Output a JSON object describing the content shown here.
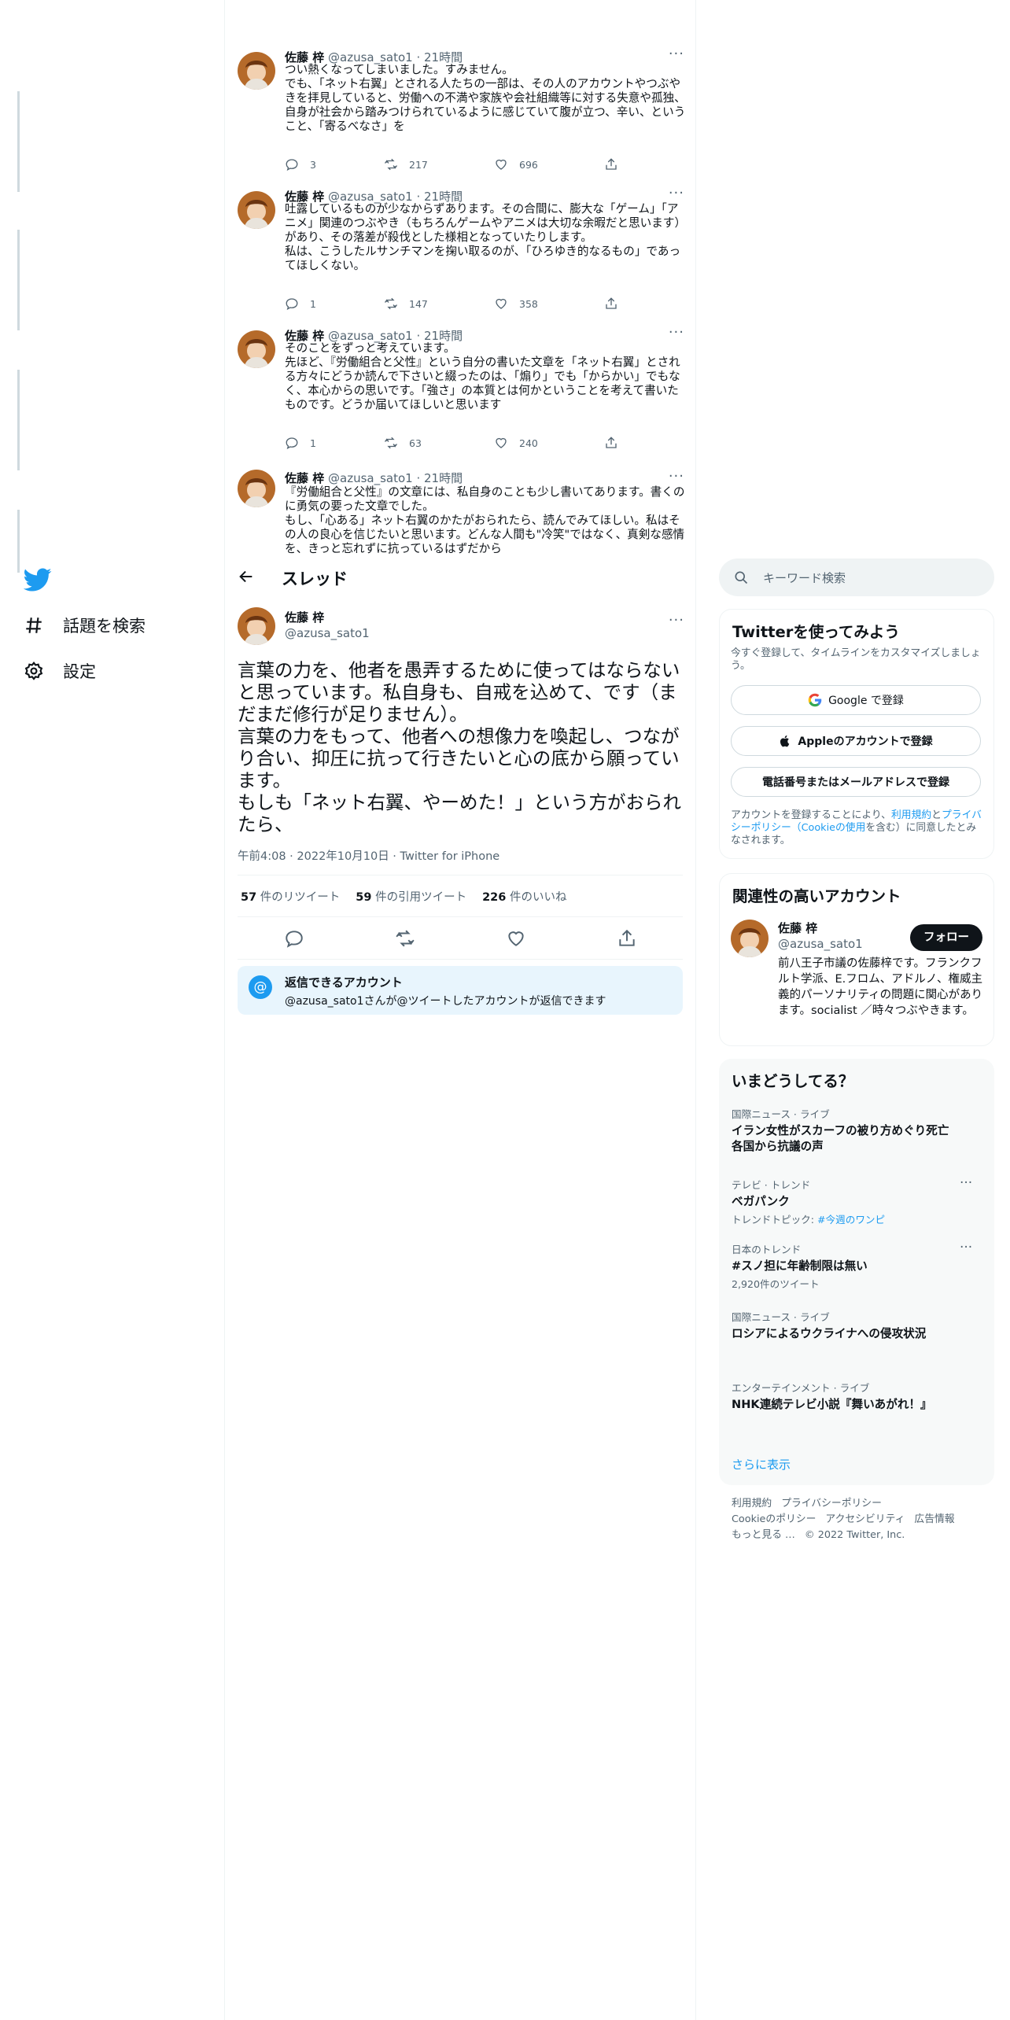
{
  "nav": {
    "search_label": "話題を検索",
    "settings_label": "設定"
  },
  "thread": [
    {
      "name": "佐藤 梓",
      "handle": "@azusa_sato1 · 21時間",
      "text": "つい熱くなってしまいました。すみません。\nでも、「ネット右翼」とされる人たちの一部は、その人のアカウントやつぶやきを拝見していると、労働への不満や家族や会社組織等に対する失意や孤独、自身が社会から踏みつけられているように感じていて腹が立つ、辛い、ということ、「寄るべなさ」を",
      "reply": "3",
      "retweet": "217",
      "like": "696"
    },
    {
      "name": "佐藤 梓",
      "handle": "@azusa_sato1 · 21時間",
      "text": "吐露しているものが少なからずあります。その合間に、膨大な「ゲーム」「アニメ」関連のつぶやき（もちろんゲームやアニメは大切な余暇だと思います）があり、その落差が殺伐とした様相となっていたりします。\n私は、こうしたルサンチマンを掬い取るのが、「ひろゆき的なるもの」であってほしくない。",
      "reply": "1",
      "retweet": "147",
      "like": "358"
    },
    {
      "name": "佐藤 梓",
      "handle": "@azusa_sato1 · 21時間",
      "text": "そのことをずっと考えています。\n先ほど、『労働組合と父性』という自分の書いた文章を「ネット右翼」とされる方々にどうか読んで下さいと綴ったのは、「煽り」でも「からかい」でもなく、本心からの思いです。「強さ」の本質とは何かということを考えて書いたものです。どうか届いてほしいと思います",
      "reply": "1",
      "retweet": "63",
      "like": "240"
    },
    {
      "name": "佐藤 梓",
      "handle": "@azusa_sato1 · 21時間",
      "text": "『労働組合と父性』の文章には、私自身のことも少し書いてあります。書くのに勇気の要った文章でした。\nもし、「心ある」ネット右翼のかたがおられたら、読んでみてほしい。私はその人の良心を信じたいと思います。どんな人間も\"冷笑\"ではなく、真剣な感情を、きっと忘れずに抗っているはずだから"
    }
  ],
  "header": {
    "title": "スレッド"
  },
  "main_tweet": {
    "name": "佐藤 梓",
    "handle": "@azusa_sato1",
    "text": "言葉の力を、他者を愚弄するために使ってはならないと思っています。私自身も、自戒を込めて、です（まだまだ修行が足りません）。\n言葉の力をもって、他者への想像力を喚起し、つながり合い、抑圧に抗って行きたいと心の底から願っています。\nもしも「ネット右翼、やーめた！」という方がおられたら、",
    "meta": "午前4:08 · 2022年10月10日 · Twitter for iPhone",
    "retweets": "57",
    "retweets_label": "件のリツイート",
    "quotes": "59",
    "quotes_label": "件の引用ツイート",
    "likes": "226",
    "likes_label": "件のいいね"
  },
  "reply_notice": {
    "title": "返信できるアカウント",
    "text": "@azusa_sato1さんが@ツイートしたアカウントが返信できます"
  },
  "search": {
    "placeholder": "キーワード検索"
  },
  "signup": {
    "title": "Twitterを使ってみよう",
    "subtitle": "今すぐ登録して、タイムラインをカスタマイズしましょう。",
    "google": "Google で登録",
    "apple": "Appleのアカウントで登録",
    "phone": "電話番号またはメールアドレスで登録",
    "legal_1": "アカウントを登録することにより、",
    "legal_terms": "利用規約",
    "legal_2": "と",
    "legal_privacy": "プライバシーポリシー（Cookieの使用",
    "legal_3": "を含む）に同意したとみなされます。"
  },
  "related": {
    "title": "関連性の高いアカウント",
    "name": "佐藤 梓",
    "handle": "@azusa_sato1",
    "follow": "フォロー",
    "bio": "前八王子市議の佐藤梓です。フランクフルト学派、E.フロム、アドルノ、権威主義的パーソナリティの問題に関心があります。socialist ／時々つぶやきます。"
  },
  "trends": {
    "title": "いまどうしてる？",
    "items": [
      {
        "cat": "国際ニュース · ライブ",
        "title": "イラン女性がスカーフの被り方めぐり死亡 各国から抗議の声"
      },
      {
        "cat": "テレビ · トレンド",
        "title": "ベガパンク",
        "sub_pre": "トレンドトピック: ",
        "sub_link": "#今週のワンピ"
      },
      {
        "cat": "日本のトレンド",
        "title": "#スノ担に年齢制限は無い",
        "sub": "2,920件のツイート"
      },
      {
        "cat": "国際ニュース · ライブ",
        "title": "ロシアによるウクライナへの侵攻状況"
      },
      {
        "cat": "エンターテインメント · ライブ",
        "title": "NHK連続テレビ小説『舞いあがれ！』"
      }
    ],
    "show_more": "さらに表示"
  },
  "footer": {
    "terms": "利用規約",
    "privacy": "プライバシーポリシー",
    "cookie": "Cookieのポリシー",
    "access": "アクセシビリティ",
    "ads": "広告情報",
    "more": "もっと見る …",
    "copy": "© 2022 Twitter, Inc."
  },
  "colors": {
    "accent": "#1d9bf0",
    "text": "#0f1419",
    "muted": "#536471"
  }
}
